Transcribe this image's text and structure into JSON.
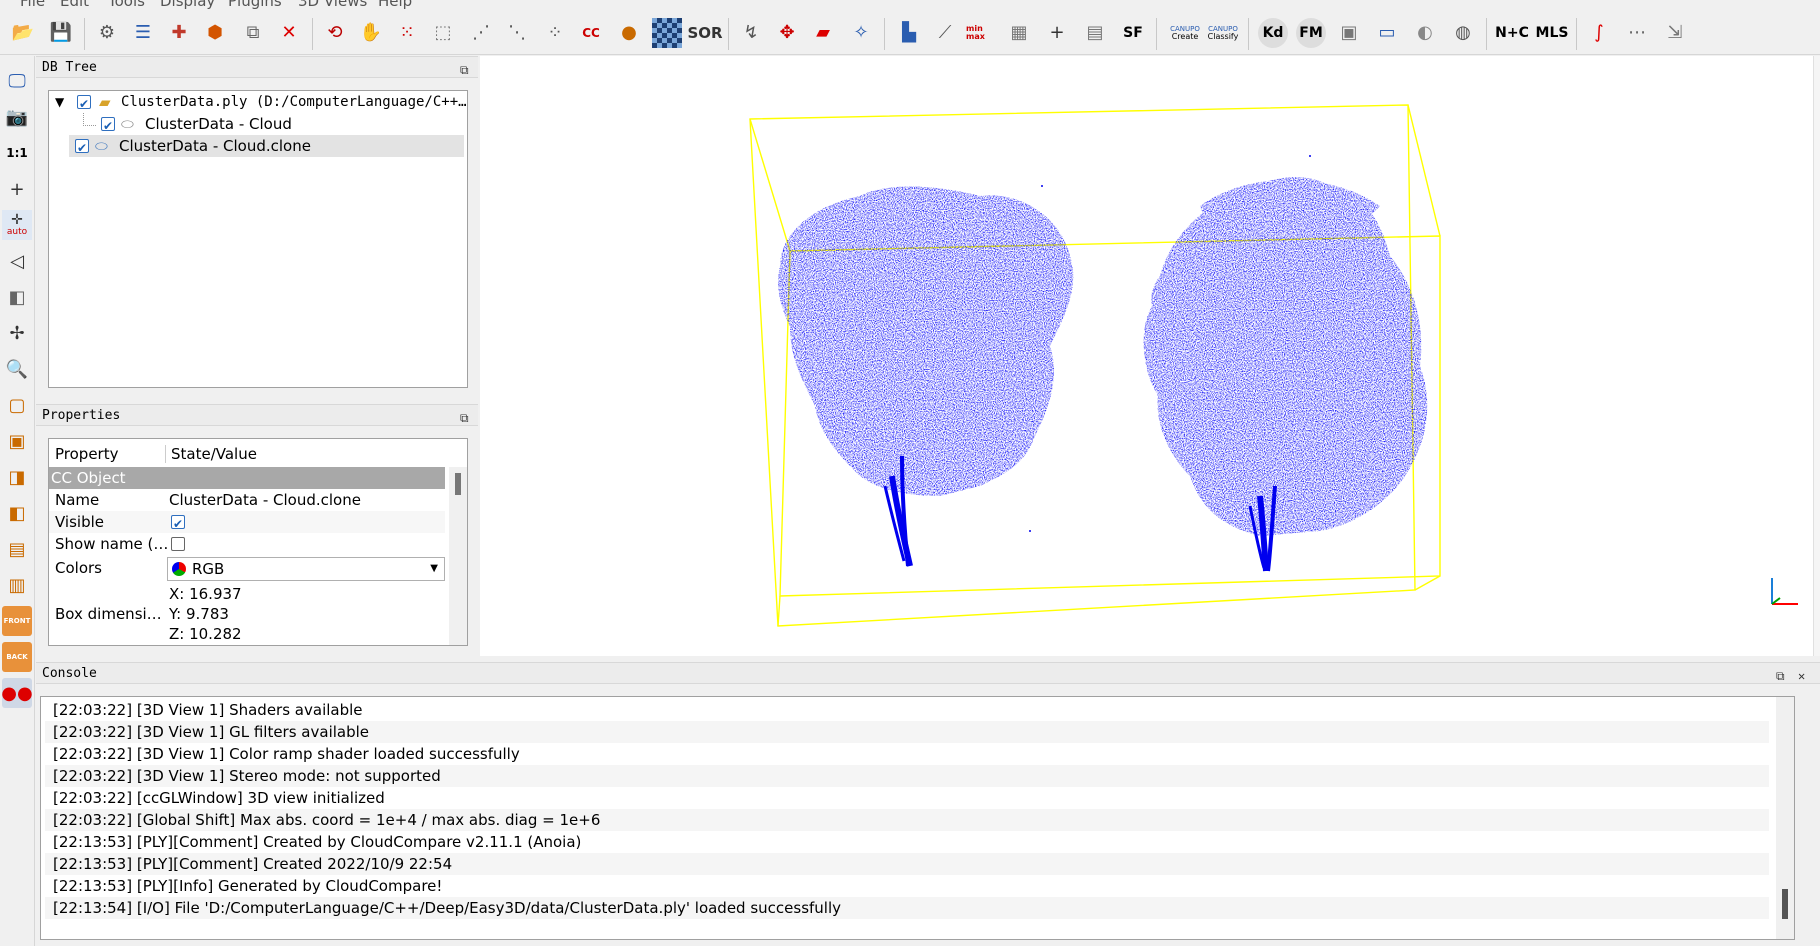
{
  "menu": [
    "File",
    "Edit",
    "Tools",
    "Display",
    "Plugins",
    "3D Views",
    "Help"
  ],
  "toolbar": {
    "sor_label": "SOR",
    "sf_label": "SF",
    "kd_label": "Kd",
    "fm_label": "FM",
    "nc_label": "N+C",
    "mls_label": "MLS",
    "canupo_create": "Create",
    "canupo_classify": "Classify",
    "canupo_title": "CANUPO",
    "cc_label": "CC",
    "minmax_label": "min max"
  },
  "left_toolbar": {
    "one_to_one": "1:1",
    "auto_label": "auto",
    "front_label": "FRONT",
    "back_label": "BACK"
  },
  "db_tree": {
    "title": "DB Tree",
    "items": [
      {
        "label": "ClusterData.ply (D:/ComputerLanguage/C++…",
        "checked": true,
        "level": 0
      },
      {
        "label": "ClusterData - Cloud",
        "checked": true,
        "level": 1
      },
      {
        "label": "ClusterData - Cloud.clone",
        "checked": true,
        "level": 0,
        "selected": true
      }
    ]
  },
  "properties": {
    "title": "Properties",
    "header_property": "Property",
    "header_value": "State/Value",
    "section": "CC Object",
    "rows": {
      "name_label": "Name",
      "name_value": "ClusterData - Cloud.clone",
      "visible_label": "Visible",
      "showname_label": "Show name (…",
      "colors_label": "Colors",
      "colors_value": "RGB",
      "box_label": "Box dimensi…",
      "box_x": "X: 16.937",
      "box_y": "Y: 9.783",
      "box_z": "Z: 10.282"
    }
  },
  "console": {
    "title": "Console",
    "lines": [
      "[22:03:22] [3D View 1] Shaders available",
      "[22:03:22] [3D View 1] GL filters available",
      "[22:03:22] [3D View 1] Color ramp shader loaded successfully",
      "[22:03:22] [3D View 1] Stereo mode: not supported",
      "[22:03:22] [ccGLWindow] 3D view initialized",
      "[22:03:22] [Global Shift] Max abs. coord = 1e+4 / max abs. diag = 1e+6",
      "[22:13:53] [PLY][Comment] Created by CloudCompare v2.11.1 (Anoia)",
      "[22:13:53] [PLY][Comment] Created 2022/10/9 22:54",
      "[22:13:53] [PLY][Info] Generated by CloudCompare!",
      "[22:13:54] [I/O] File 'D:/ComputerLanguage/C++/Deep/Easy3D/data/ClusterData.ply' loaded successfully"
    ]
  },
  "colors": {
    "point_cloud": "#0000ee",
    "bbox": "#ffff00",
    "axis_red": "#ff0000",
    "axis_blue": "#1a7fd8",
    "selection": "#e3e3e3",
    "section": "#a8a8a8"
  }
}
